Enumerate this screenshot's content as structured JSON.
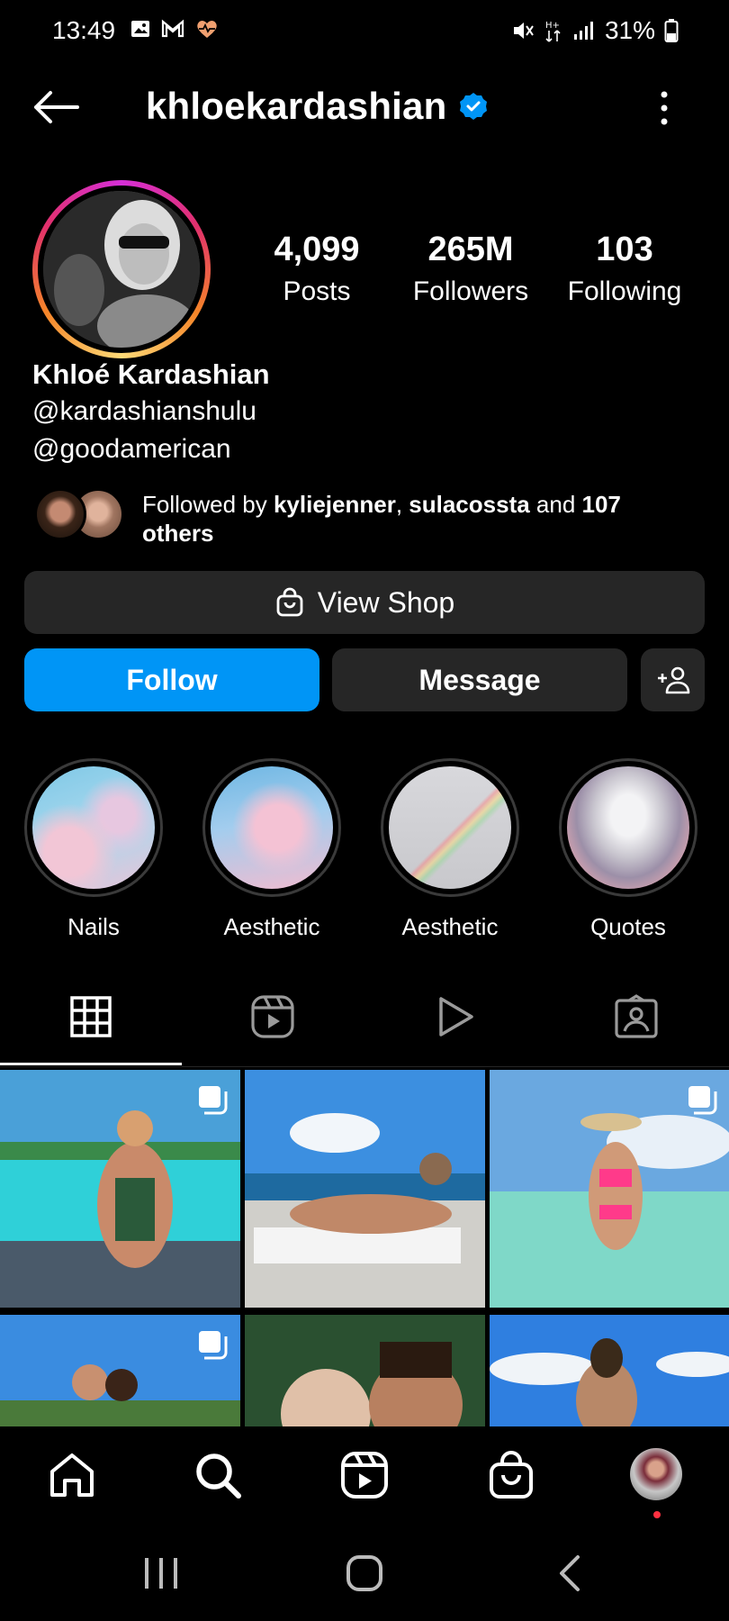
{
  "status_bar": {
    "time": "13:49",
    "battery": "31%",
    "icons": [
      "gallery-icon",
      "gmail-icon",
      "heart-monitor-icon",
      "mute-icon",
      "data-icon",
      "signal-icon",
      "battery-icon"
    ]
  },
  "header": {
    "username": "khloekardashian",
    "verified": true,
    "back_icon": "back-arrow-icon",
    "menu_icon": "kebab-menu-icon"
  },
  "profile": {
    "stats": [
      {
        "value": "4,099",
        "label": "Posts"
      },
      {
        "value": "265M",
        "label": "Followers"
      },
      {
        "value": "103",
        "label": "Following"
      }
    ],
    "full_name": "Khloé Kardashian",
    "bio": [
      "@kardashianshulu",
      "@goodamerican"
    ],
    "followed_by": {
      "prefix": "Followed by ",
      "user1": "kyliejenner",
      "sep": ", ",
      "user2": "sulacossta",
      "mid": " and ",
      "others": "107 others"
    }
  },
  "buttons": {
    "view_shop": "View Shop",
    "follow": "Follow",
    "message": "Message"
  },
  "highlights": [
    {
      "label": "Nails"
    },
    {
      "label": "Aesthetic"
    },
    {
      "label": "Aesthetic"
    },
    {
      "label": "Quotes"
    }
  ],
  "tabs": [
    "grid-icon",
    "reels-icon",
    "videos-icon",
    "tagged-icon"
  ],
  "colors": {
    "accent": "#0095f6",
    "button_dark": "#262626",
    "background": "#000000",
    "verified": "#0095f6"
  },
  "bottom_nav": [
    "home-icon",
    "search-icon",
    "reels-icon",
    "shop-icon",
    "profile-avatar"
  ]
}
